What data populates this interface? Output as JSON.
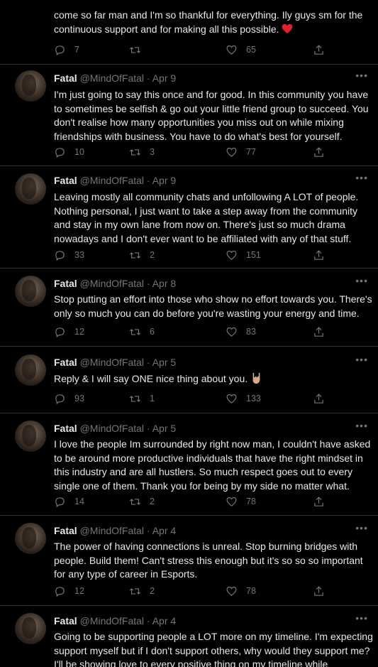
{
  "colors": {
    "background": "#000000",
    "text": "#e7e9ea",
    "muted": "#71767b",
    "divider": "#2f3336",
    "heart": "#f91880"
  },
  "tweets": [
    {
      "partial": true,
      "text": "come so far man and I'm so thankful for everything. Ily guys sm for the continuous support and for making all this possible.",
      "emoji": "red-heart",
      "replies": "7",
      "retweets": "",
      "likes": "65"
    },
    {
      "name": "Fatal",
      "handle": "@MindOfFatal",
      "date": "Apr 9",
      "text": "I'm just going to say this once and for good. In this community you have to sometimes be selfish & go out your little friend group to succeed. You don't realise how many opportunities you miss out on while mixing friendships with business. You have to do what's best for yourself.",
      "replies": "10",
      "retweets": "3",
      "likes": "77"
    },
    {
      "name": "Fatal",
      "handle": "@MindOfFatal",
      "date": "Apr 9",
      "text": "Leaving mostly all community chats and unfollowing A LOT of people. Nothing personal, I just want to take a step away from the community and stay in my own lane from now on. There's just so much drama nowadays and I don't ever want to be affiliated with any of that stuff.",
      "replies": "33",
      "retweets": "2",
      "likes": "151"
    },
    {
      "name": "Fatal",
      "handle": "@MindOfFatal",
      "date": "Apr 8",
      "text": "Stop putting an effort into those who show no effort towards you. There's only so much you can do before you're wasting your energy and time.",
      "replies": "12",
      "retweets": "6",
      "likes": "83"
    },
    {
      "name": "Fatal",
      "handle": "@MindOfFatal",
      "date": "Apr 5",
      "text": "Reply & I will say ONE nice thing about you.",
      "emoji": "rock-on-hand",
      "replies": "93",
      "retweets": "1",
      "likes": "133"
    },
    {
      "name": "Fatal",
      "handle": "@MindOfFatal",
      "date": "Apr 5",
      "text": "I love the people Im surrounded by right now man, I couldn't have asked to be around more productive individuals that have the right mindset in this industry and are all hustlers. So much respect goes out to every single one of them. Thank you for being by my side no matter what.",
      "replies": "14",
      "retweets": "2",
      "likes": "78"
    },
    {
      "name": "Fatal",
      "handle": "@MindOfFatal",
      "date": "Apr 4",
      "text": "The power of having connections is unreal. Stop burning bridges with people. Build them! Can't stress this enough but it's so so so important for any type of career in Esports.",
      "replies": "12",
      "retweets": "2",
      "likes": "78"
    },
    {
      "name": "Fatal",
      "handle": "@MindOfFatal",
      "date": "Apr 4",
      "text": "Going to be supporting people a LOT more on my timeline. I'm expecting support myself but if I don't support others, why would they support me? I'll be showing love to every positive thing on my timeline while maintaining",
      "replies": "",
      "retweets": "",
      "likes": ""
    }
  ],
  "ui": {
    "more_label": "•••",
    "separator": " · "
  }
}
